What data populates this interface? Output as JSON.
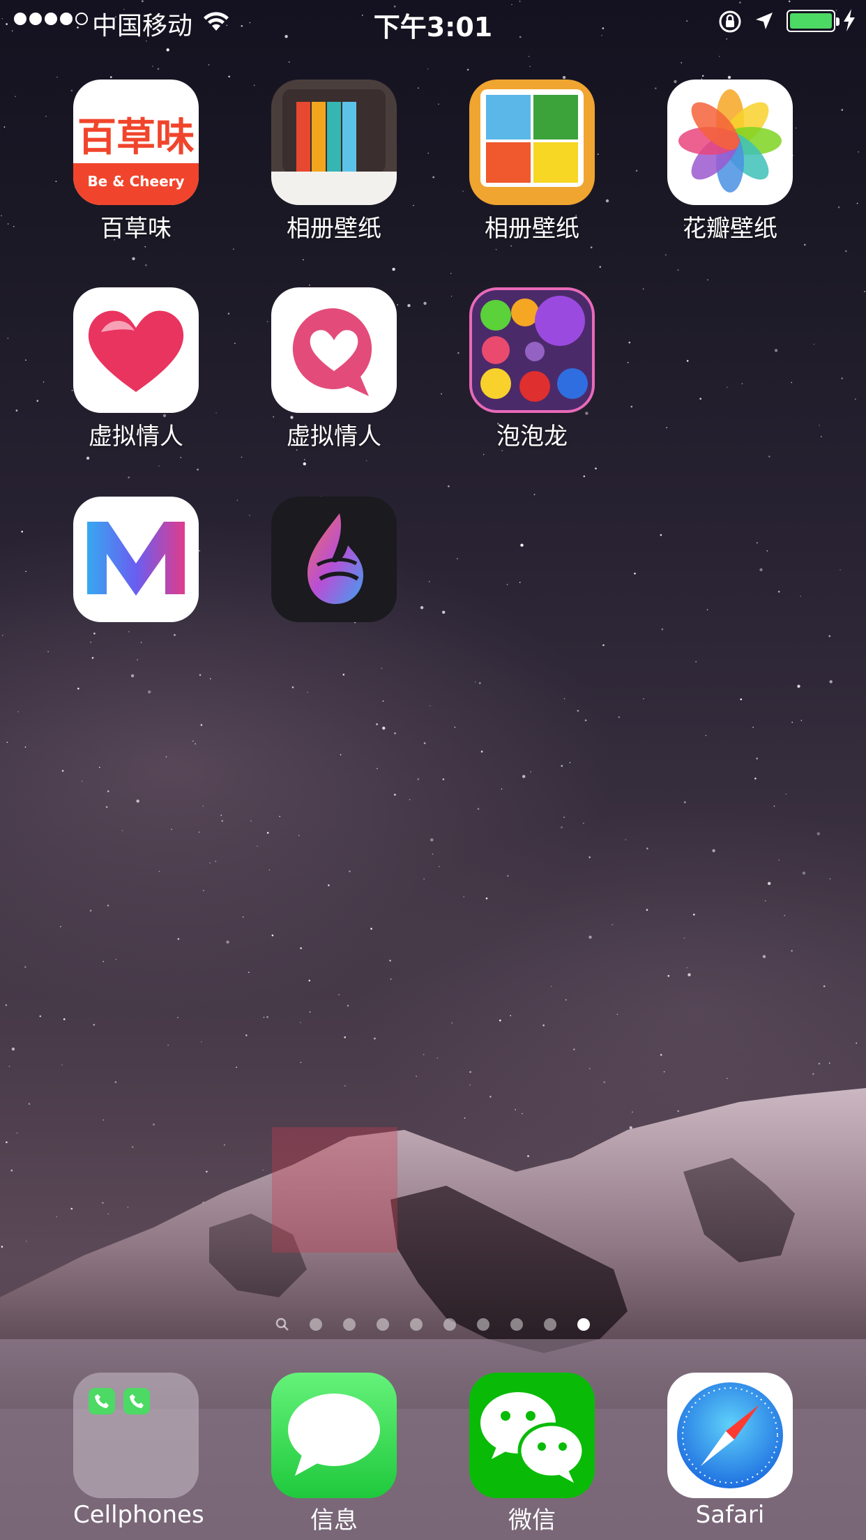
{
  "status_bar": {
    "signal_icon": "signal-dots",
    "carrier": "中国移动",
    "wifi_icon": "wifi-icon",
    "time": "下午3:01",
    "lock_icon": "rotation-lock-icon",
    "location_icon": "location-arrow-icon",
    "battery_level": 1.0,
    "charging_icon": "bolt-icon"
  },
  "apps": [
    {
      "name": "百草味",
      "icon": "baicaowei-icon",
      "brand_text": "百草味",
      "brand_sub": "Be & Cheery"
    },
    {
      "name": "相册壁纸",
      "icon": "album-wallpaper-icon"
    },
    {
      "name": "相册壁纸",
      "icon": "photo-wallpaper-icon"
    },
    {
      "name": "花瓣壁纸",
      "icon": "petal-wallpaper-icon"
    },
    {
      "name": "虚拟情人",
      "icon": "heart-icon"
    },
    {
      "name": "虚拟情人",
      "icon": "heart-bubble-icon"
    },
    {
      "name": "泡泡龙",
      "icon": "bubble-game-icon"
    },
    {
      "name": "",
      "icon": "m-logo-icon"
    },
    {
      "name": "",
      "icon": "flame-icon"
    }
  ],
  "page_indicator": {
    "total": 9,
    "current": 9,
    "search_icon": "search-icon"
  },
  "dock": [
    {
      "name": "Cellphones",
      "icon": "folder-icon"
    },
    {
      "name": "信息",
      "icon": "messages-icon"
    },
    {
      "name": "微信",
      "icon": "wechat-icon"
    },
    {
      "name": "Safari",
      "icon": "safari-compass-icon"
    }
  ],
  "colors": {
    "battery_fill": "#4cd964",
    "baicaowei_red": "#f0452c",
    "messages_green": "#4cd964",
    "wechat_green": "#09bb07"
  }
}
